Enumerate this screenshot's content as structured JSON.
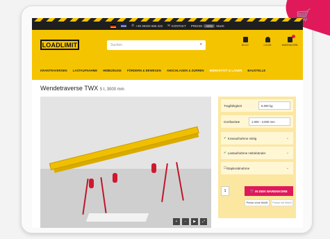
{
  "topbar": {
    "phone": "+49 36333 666 222",
    "contact": "KONTAKT",
    "prices": "PREISE",
    "net": "netto",
    "gross": "MwSt"
  },
  "header": {
    "logo": "LOADLIMIT",
    "search_placeholder": "Suchen",
    "icons": [
      {
        "label": "BLOG",
        "icon": "document-icon"
      },
      {
        "label": "LOGIN",
        "icon": "user-icon"
      },
      {
        "label": "WARENKORB",
        "icon": "cart-icon"
      }
    ]
  },
  "nav": {
    "items": [
      "KRANTRAVERSEN",
      "LASTAUFNAHME",
      "HEBEZEUGE",
      "FÖRDERN & BEWEGEN",
      "ANSCHLAGEN & ZURREN",
      "WERKSTATT & LAGER",
      "BAUSTELLE"
    ]
  },
  "product": {
    "title": "Wendetraverse TWX",
    "spec": "5 t, 3000 mm"
  },
  "config": {
    "load_label": "Tragfähigkeit",
    "load_value": "5.000 kg",
    "width_label": "Greifweite",
    "width_value": "1.000 - 3.000 mm",
    "opt1": "Kranaufnahme mittig",
    "opt2": "Lastaufnahme Hebebänder",
    "opt3": "Staplerabnahme",
    "qty": "1",
    "cart_button": "IN DEN WARENKORB",
    "price_net": "Preise ohne MwSt",
    "price_gross": "Preise mit MwSt"
  },
  "colors": {
    "brand_yellow": "#f5c400",
    "accent_pink": "#e0195b",
    "dark": "#1e1e1e"
  }
}
